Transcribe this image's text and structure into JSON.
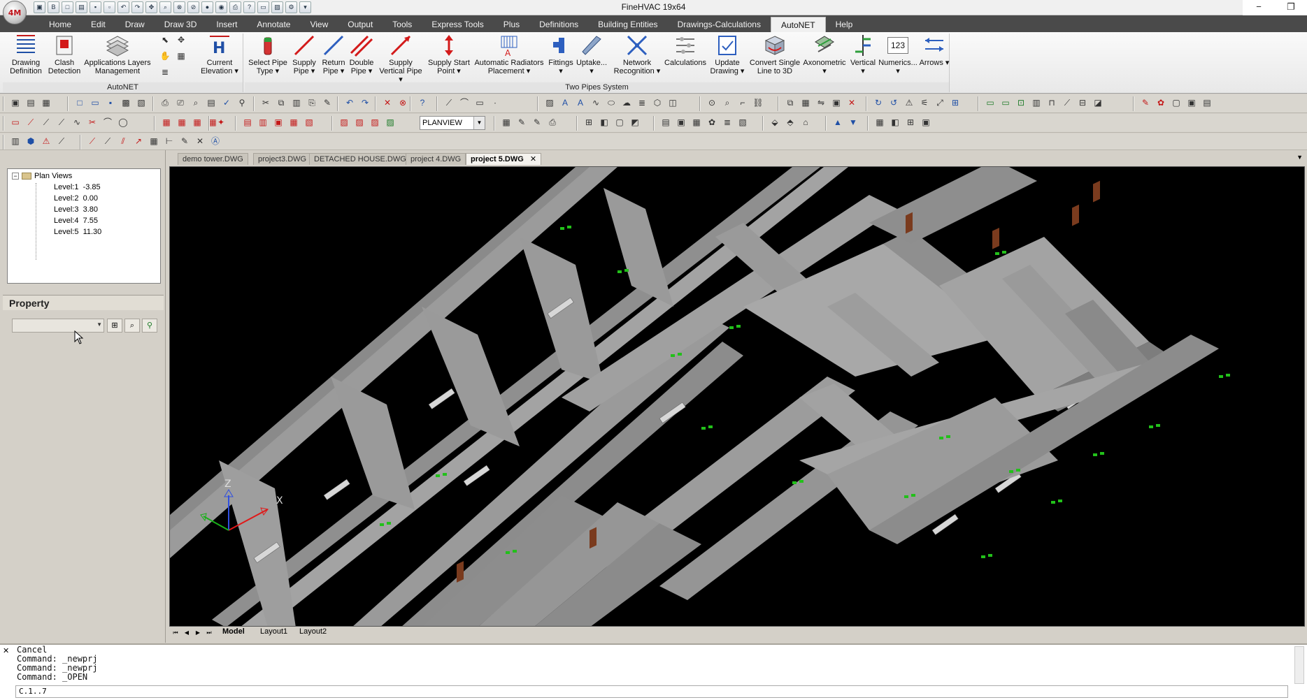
{
  "app": {
    "title": "FineHVAC 19x64",
    "logo_text": "4M"
  },
  "window": {
    "minimize": "−",
    "restore": "❐",
    "close": ""
  },
  "menu": {
    "tabs": [
      {
        "label": "Home"
      },
      {
        "label": "Edit"
      },
      {
        "label": "Draw"
      },
      {
        "label": "Draw 3D"
      },
      {
        "label": "Insert"
      },
      {
        "label": "Annotate"
      },
      {
        "label": "View"
      },
      {
        "label": "Output"
      },
      {
        "label": "Tools"
      },
      {
        "label": "Express Tools"
      },
      {
        "label": "Plus"
      },
      {
        "label": "Definitions"
      },
      {
        "label": "Building Entities"
      },
      {
        "label": "Drawings-Calculations"
      },
      {
        "label": "AutoNET"
      },
      {
        "label": "Help"
      }
    ],
    "active": "AutoNET"
  },
  "ribbon": {
    "groups": [
      {
        "name": "AutoNET"
      },
      {
        "name": "Two Pipes System"
      }
    ],
    "buttons": [
      {
        "label": "Drawing Definition",
        "icon": "drawing-definition-icon"
      },
      {
        "label": "Clash Detection",
        "icon": "clash-detection-icon"
      },
      {
        "label": "Applications Layers Management",
        "icon": "layers-icon"
      },
      {
        "label": "Current Elevation ▾",
        "icon": "elevation-icon"
      },
      {
        "label": "Select Pipe Type ▾",
        "icon": "pipe-type-icon"
      },
      {
        "label": "Supply Pipe ▾",
        "icon": "supply-pipe-icon"
      },
      {
        "label": "Return Pipe ▾",
        "icon": "return-pipe-icon"
      },
      {
        "label": "Double Pipe ▾",
        "icon": "double-pipe-icon"
      },
      {
        "label": "Supply Vertical Pipe ▾",
        "icon": "vertical-pipe-icon"
      },
      {
        "label": "Supply Start Point ▾",
        "icon": "start-point-icon"
      },
      {
        "label": "Automatic Radiators Placement ▾",
        "icon": "radiator-icon"
      },
      {
        "label": "Fittings ▾",
        "icon": "fittings-icon"
      },
      {
        "label": "Uptake... ▾",
        "icon": "uptake-icon"
      },
      {
        "label": "Network Recognition ▾",
        "icon": "network-icon"
      },
      {
        "label": "Calculations",
        "icon": "calculations-icon"
      },
      {
        "label": "Update Drawing ▾",
        "icon": "update-drawing-icon"
      },
      {
        "label": "Convert Single Line to 3D",
        "icon": "convert-3d-icon"
      },
      {
        "label": "Axonometric ▾",
        "icon": "axonometric-icon"
      },
      {
        "label": "Vertical ▾",
        "icon": "vertical-icon"
      },
      {
        "label": "Numerics... ▾",
        "icon": "numerics-icon",
        "badge": "123"
      },
      {
        "label": "Arrows ▾",
        "icon": "arrows-icon"
      }
    ]
  },
  "toolbar": {
    "view_select": "PLANVIEW"
  },
  "tree": {
    "root": "Plan Views",
    "items": [
      {
        "label": "Level:1  -3.85"
      },
      {
        "label": "Level:2  0.00"
      },
      {
        "label": "Level:3  3.80"
      },
      {
        "label": "Level:4  7.55"
      },
      {
        "label": "Level:5  11.30"
      }
    ]
  },
  "property": {
    "title": "Property",
    "select_value": ""
  },
  "documents": {
    "tabs": [
      {
        "label": "demo tower.DWG"
      },
      {
        "label": "project3.DWG"
      },
      {
        "label": "DETACHED HOUSE.DWG"
      },
      {
        "label": "project 4.DWG"
      },
      {
        "label": "project 5.DWG"
      }
    ],
    "active_close": "✕"
  },
  "viewport": {
    "axis_z": "Z",
    "axis_x": "X"
  },
  "layout_tabs": {
    "tabs": [
      {
        "label": "Model"
      },
      {
        "label": "Layout1"
      },
      {
        "label": "Layout2"
      }
    ]
  },
  "command": {
    "history": "Cancel\nCommand: _newprj\nCommand: _newprj\nCommand: _OPEN",
    "prompt": "C.1..7"
  },
  "colors": {
    "menubar": "#4a4a4a",
    "viewport_bg": "#000000",
    "wall": "#9b9b9b",
    "pipe_marker": "#22c01a",
    "door": "#7a3b1e",
    "accent_red": "#c41818"
  }
}
